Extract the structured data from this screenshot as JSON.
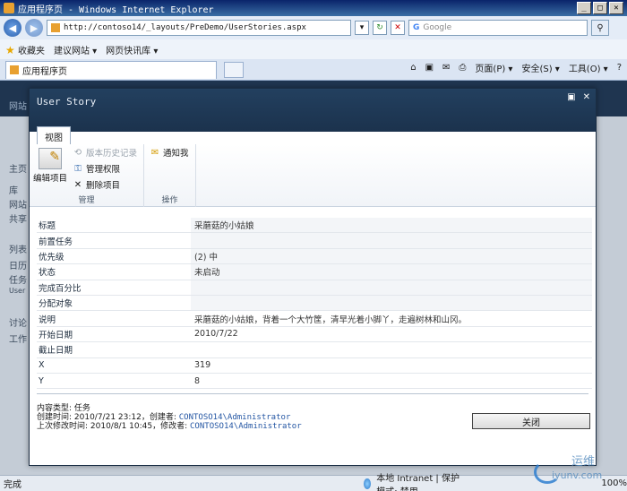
{
  "browser": {
    "title": "应用程序页 - Windows Internet Explorer",
    "url": "http://contoso14/_layouts/PreDemo/UserStories.aspx",
    "search_placeholder": "Google",
    "favorites_label": "收藏夹",
    "fav_items": [
      "建议网站 ▾",
      "网页快讯库 ▾"
    ],
    "tab_title": "应用程序页",
    "cmd_items": [
      "页面(P) ▾",
      "安全(S) ▾",
      "工具(O) ▾"
    ],
    "status_text": "完成",
    "zone_text": "本地 Intranet | 保护模式: 禁用",
    "zoom": "100%"
  },
  "bg_page": {
    "items": [
      "网站",
      "主页",
      "库",
      "网站",
      "共享",
      "列表",
      "日历",
      "任务",
      "User",
      "讨论",
      "工作"
    ]
  },
  "dialog": {
    "title": "User Story",
    "ribbon_tab": "视图",
    "groups": {
      "manage": {
        "label": "管理",
        "edit_item": "编辑项目",
        "version_history": "版本历史记录",
        "manage_permissions": "管理权限",
        "delete_item": "删除项目"
      },
      "actions": {
        "label": "操作",
        "alert_me": "通知我"
      }
    },
    "fields": [
      {
        "label": "标题",
        "value": "采蘑菇的小姑娘"
      },
      {
        "label": "前置任务",
        "value": ""
      },
      {
        "label": "优先级",
        "value": "(2) 中"
      },
      {
        "label": "状态",
        "value": "未启动"
      },
      {
        "label": "完成百分比",
        "value": ""
      },
      {
        "label": "分配对象",
        "value": ""
      },
      {
        "label": "说明",
        "value": "采蘑菇的小姑娘，背着一个大竹筐，清早光着小脚丫，走遍树林和山冈。"
      },
      {
        "label": "开始日期",
        "value": "2010/7/22"
      },
      {
        "label": "截止日期",
        "value": ""
      },
      {
        "label": "X",
        "value": "319"
      },
      {
        "label": "Y",
        "value": "8"
      }
    ],
    "content_type": "内容类型: 任务",
    "created": "创建时间: 2010/7/21 23:12，创建者: ",
    "created_by": "CONTOSO14\\Administrator",
    "modified": "上次修改时间: 2010/8/1 10:45，修改者: ",
    "modified_by": "CONTOSO14\\Administrator",
    "close_label": "关闭"
  },
  "watermark": {
    "top": "运维",
    "bottom": "iyunv.com"
  }
}
